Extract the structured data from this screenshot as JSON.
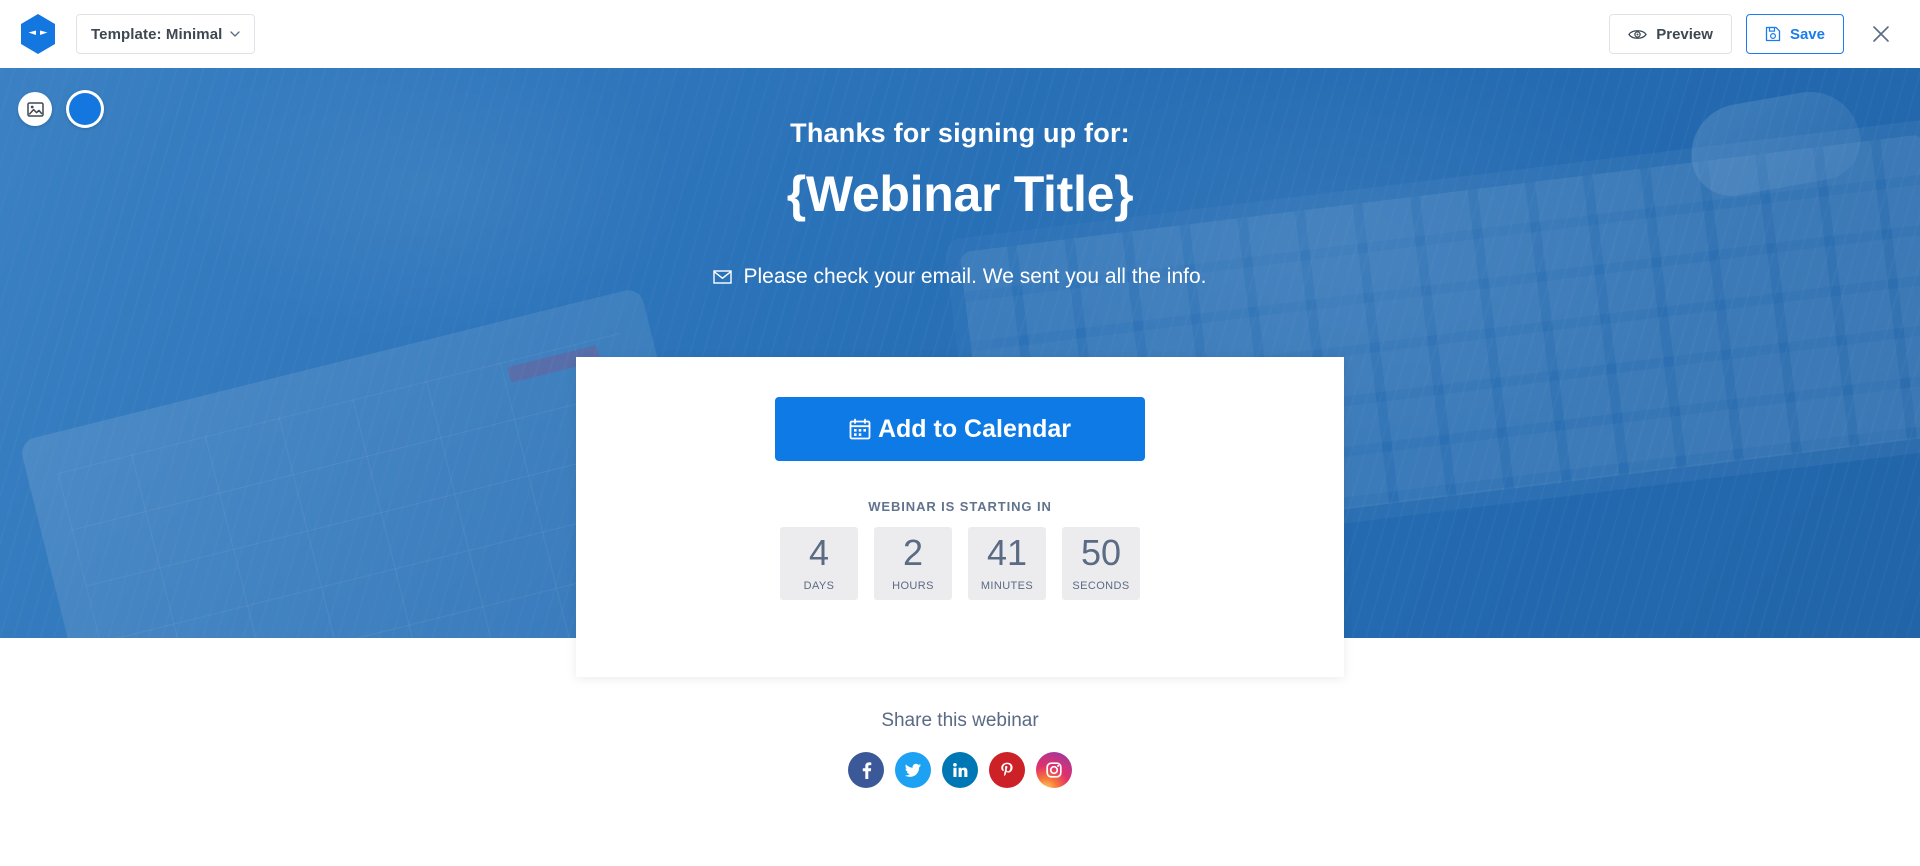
{
  "topbar": {
    "logo_name": "demio-hexagon-logo",
    "template_label": "Template: Minimal",
    "preview_label": "Preview",
    "save_label": "Save",
    "close_label": "×"
  },
  "hero": {
    "image_button_icon": "image-icon",
    "color_swatch": "#1477e0",
    "kicker": "Thanks for signing up for:",
    "title": "{Webinar Title}",
    "email_notice": "Please check your email. We sent you all the info.",
    "overlay_color": "#2a6bb0"
  },
  "card": {
    "cta_label": "Add to Calendar",
    "cta_color": "#0d7ae5",
    "countdown_label": "WEBINAR IS STARTING IN",
    "countdown": [
      {
        "value": "4",
        "unit": "DAYS"
      },
      {
        "value": "2",
        "unit": "HOURS"
      },
      {
        "value": "41",
        "unit": "MINUTES"
      },
      {
        "value": "50",
        "unit": "SECONDS"
      }
    ]
  },
  "share": {
    "title": "Share this webinar",
    "networks": [
      {
        "name": "facebook",
        "color": "#3b5998"
      },
      {
        "name": "twitter",
        "color": "#1da1f2"
      },
      {
        "name": "linkedin",
        "color": "#0077b5"
      },
      {
        "name": "pinterest",
        "color": "#cc2127"
      },
      {
        "name": "instagram",
        "color": "#e1306c"
      }
    ]
  }
}
